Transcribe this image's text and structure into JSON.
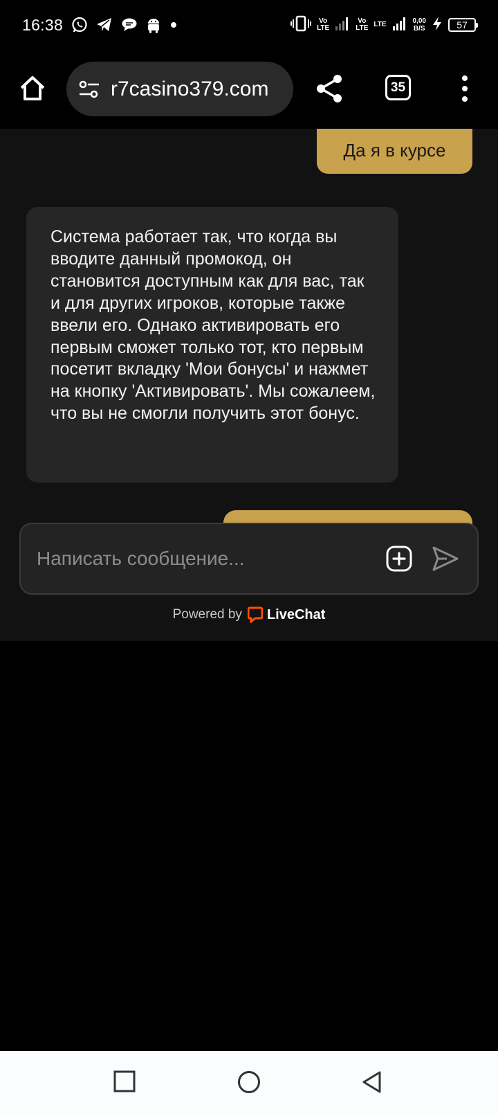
{
  "status_bar": {
    "time": "16:38",
    "net1": "Vo\nLTE",
    "net2": "Vo\nLTE",
    "net3": "LTE",
    "speed_value": "0,00",
    "speed_unit": "B/S",
    "battery": "57"
  },
  "browser": {
    "url": "r7casino379.com",
    "tab_count": "35"
  },
  "chat": {
    "messages": [
      {
        "from": "user",
        "text": "Да я в курсе"
      },
      {
        "from": "agent",
        "text": "Система работает так, что когда вы вводите данный промокод, он становится доступным как для вас, так и для других игроков, которые также ввели его. Однако активировать его первым сможет только тот, кто первым посетит вкладку 'Мои бонусы' и нажмет на кнопку 'Активировать'. Мы сожалеем, что вы не смогли получить этот бонус."
      }
    ],
    "composer_placeholder": "Написать сообщение...",
    "powered_by": "Powered by",
    "brand": "LiveChat"
  },
  "colors": {
    "user_bubble": "#c9a24d",
    "agent_bubble": "#262626",
    "chat_bg": "#121212",
    "livechat_orange": "#ff5100"
  },
  "icons": [
    "whatsapp-icon",
    "telegram-icon",
    "chat-bubble-icon",
    "android-icon",
    "vibrate-icon",
    "signal-icon",
    "charging-icon",
    "home-icon",
    "site-settings-icon",
    "share-icon",
    "tabs-icon",
    "more-icon",
    "attach-icon",
    "send-icon",
    "livechat-logo-icon",
    "recents-icon",
    "home-nav-icon",
    "back-icon"
  ]
}
